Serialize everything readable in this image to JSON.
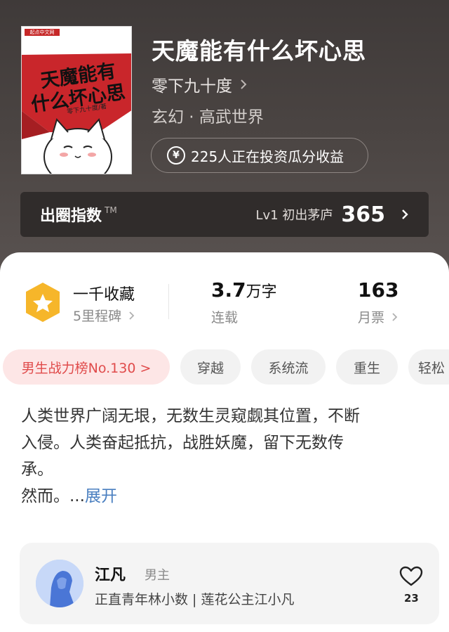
{
  "book": {
    "title": "天魔能有什么坏心思",
    "author": "零下九十度",
    "genre": "玄幻 · 高武世界",
    "invest_text": "225人正在投资瓜分收益",
    "yen_symbol": "¥"
  },
  "cover": {
    "tag": "起点中文网",
    "title_line1": "天魔能有",
    "title_line2": "什么坏心思",
    "author": "零下九十度/著"
  },
  "circle_index": {
    "title": "出圈指数",
    "tm": "TM",
    "level": "Lv1 初出茅庐",
    "score": "365"
  },
  "stats": {
    "collect_title": "一千收藏",
    "collect_sub": "5里程碑",
    "words_value": "3.7",
    "words_unit": "万字",
    "status": "连载",
    "tickets_value": "163",
    "tickets_label": "月票"
  },
  "tags": [
    "男生战力榜No.130 >",
    "穿越",
    "系统流",
    "重生",
    "轻松"
  ],
  "synopsis": {
    "line1": "人类世界广阔无垠，无数生灵窥觑其位置，不断",
    "line2": "入侵。人类奋起抵抗，战胜妖魔，留下无数传",
    "line3": "承。",
    "line4": "然而。...",
    "expand": "展开"
  },
  "character": {
    "name": "江凡",
    "role": "男主",
    "desc": "正直青年林小数 | 莲花公主江小凡",
    "likes": "23"
  },
  "colors": {
    "header_bg": "#4a4442",
    "rank_tag_bg": "#fde6e6",
    "rank_tag_text": "#e04b4b",
    "expand_link": "#4a7fc0",
    "badge": "#f6b62a"
  }
}
